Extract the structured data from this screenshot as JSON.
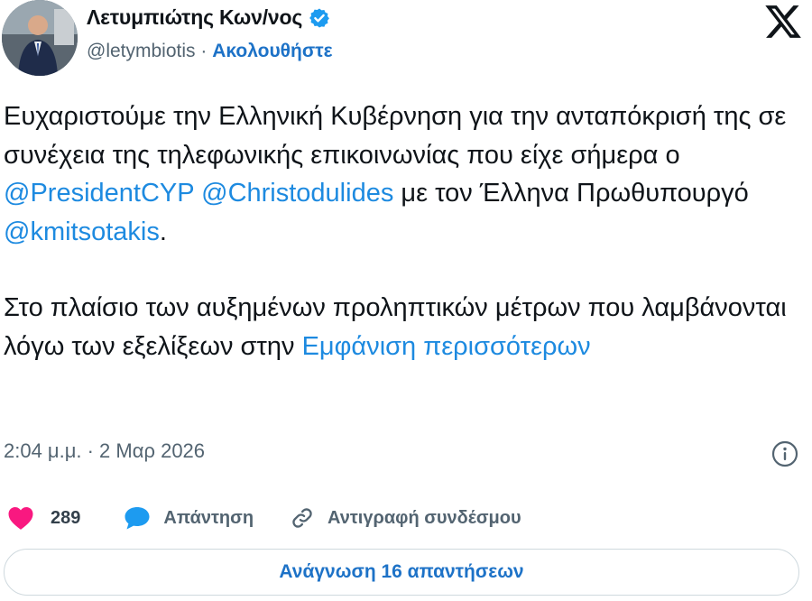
{
  "header": {
    "display_name": "Λετυμπιώτης Κων/νος",
    "handle": "@letymbiotis",
    "separator": "·",
    "follow_label": "Ακολουθήστε",
    "verified": true
  },
  "tweet": {
    "paragraph1": [
      {
        "text": "Ευχαριστούμε την Ελληνική Κυβέρνηση για την ανταπόκρισή της σε συνέχεια της τηλεφωνικής επικοινωνίας που είχε σήμερα ο "
      },
      {
        "text": "@PresidentCYP",
        "mention": true
      },
      {
        "text": " "
      },
      {
        "text": "@Christodulides",
        "mention": true
      },
      {
        "text": " με τον Έλληνα Πρωθυπουργό "
      },
      {
        "text": "@kmitsotakis",
        "mention": true
      },
      {
        "text": "."
      }
    ],
    "paragraph2_text": "Στο πλαίσιο των αυξημένων προληπτικών μέτρων που λαμβάνονται λόγω των εξελίξεων στην ",
    "show_more_label": "Εμφάνιση περισσότερων",
    "timestamp": "2:04 μ.μ. · 2 Μαρ 2026"
  },
  "actions": {
    "like_count": "289",
    "reply_label": "Απάντηση",
    "copy_link_label": "Αντιγραφή συνδέσμου"
  },
  "footer": {
    "read_replies_label": "Ανάγνωση 16 απαντήσεων"
  },
  "colors": {
    "link": "#1d8ae0",
    "verified": "#1d9bf0",
    "like": "#f91880",
    "reply_bubble": "#1d9bf0",
    "secondary_text": "#536471",
    "border": "#cfd9de"
  },
  "icons": {
    "avatar": "profile-photo",
    "verified": "verified-badge-icon",
    "platform": "x-logo-icon",
    "info": "info-icon",
    "like": "heart-icon",
    "reply": "speech-bubble-icon",
    "copy": "link-icon"
  }
}
